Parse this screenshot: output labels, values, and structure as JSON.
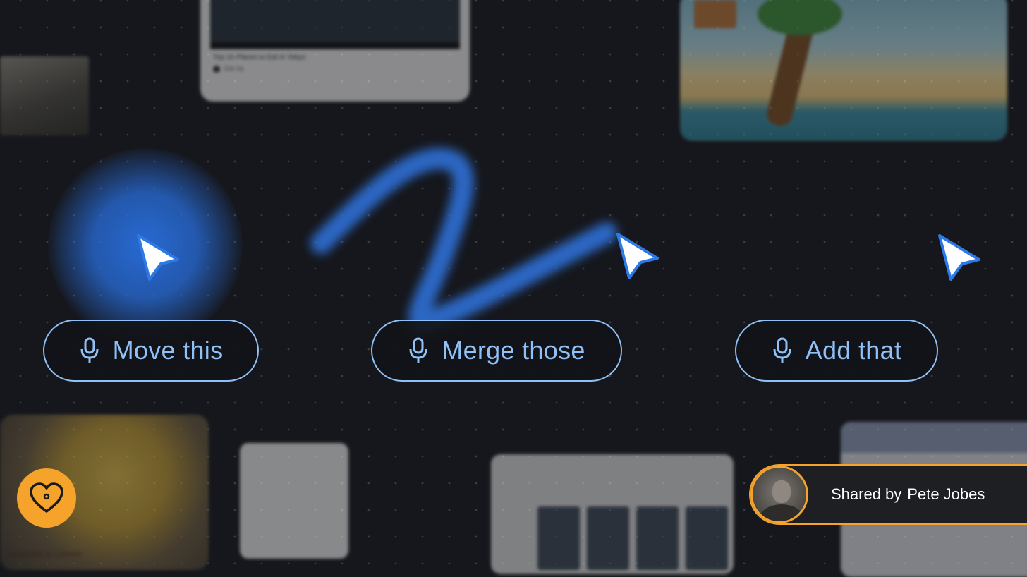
{
  "canvas": {
    "background_color": "#16171c",
    "accent_blue": "#2b74e0",
    "pill_outline_color": "#8fc0f6"
  },
  "background_cards": {
    "video_card": {
      "caption": "Top 10 Places to Eat in Tokyo",
      "channel": "Eat Up"
    },
    "recipe_card": {
      "caption": "Spaghetti al Limone"
    }
  },
  "voice_commands": [
    {
      "label": "Move this",
      "icon": "microphone-icon"
    },
    {
      "label": "Merge those",
      "icon": "microphone-icon"
    },
    {
      "label": "Add that",
      "icon": "microphone-icon"
    }
  ],
  "favorite_button": {
    "icon": "heart-icon",
    "color": "#f5a32b"
  },
  "shared_by": {
    "prefix": "Shared by",
    "name": "Pete Jobes",
    "border_color": "#f5a32b"
  }
}
